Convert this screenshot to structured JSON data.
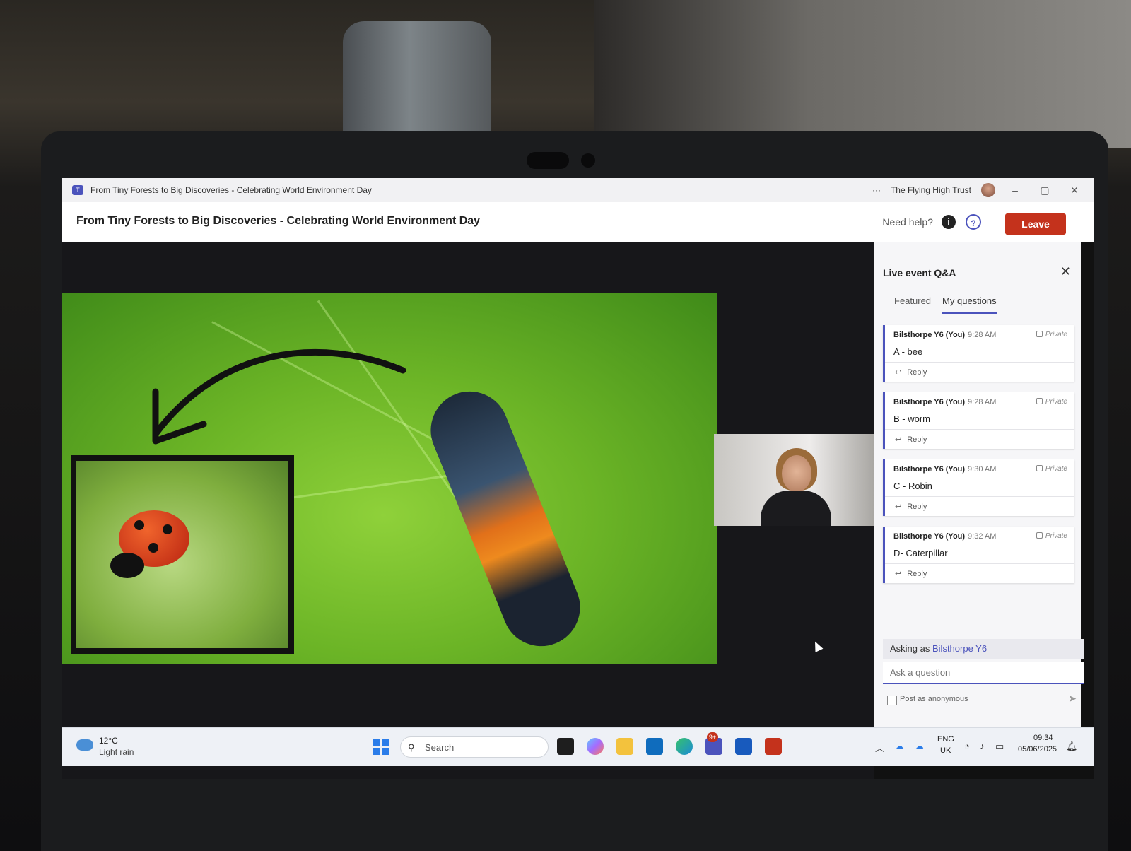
{
  "window": {
    "title": "From Tiny Forests to Big Discoveries - Celebrating World Environment Day",
    "more_label": "···",
    "org": "The Flying High Trust",
    "minimize": "–",
    "restore": "▢",
    "close": "✕"
  },
  "header": {
    "title": "From Tiny Forests to Big Discoveries - Celebrating World Environment Day",
    "need_help": "Need help?",
    "leave_label": "Leave"
  },
  "qa": {
    "title": "Live event Q&A",
    "tabs": [
      {
        "label": "Featured"
      },
      {
        "label": "My questions"
      }
    ],
    "questions": [
      {
        "author": "Bilsthorpe Y6 (You)",
        "time": "9:28 AM",
        "visibility": "Private",
        "text": "A - bee",
        "reply": "Reply"
      },
      {
        "author": "Bilsthorpe Y6 (You)",
        "time": "9:28 AM",
        "visibility": "Private",
        "text": "B - worm",
        "reply": "Reply"
      },
      {
        "author": "Bilsthorpe Y6 (You)",
        "time": "9:30 AM",
        "visibility": "Private",
        "text": "C - Robin",
        "reply": "Reply"
      },
      {
        "author": "Bilsthorpe Y6 (You)",
        "time": "9:32 AM",
        "visibility": "Private",
        "text": "D- Caterpillar",
        "reply": "Reply"
      }
    ],
    "asking_prefix": "Asking as",
    "asking_name": "Bilsthorpe Y6",
    "ask_placeholder": "Ask a question",
    "anonymous_label": "Post as anonymous"
  },
  "taskbar": {
    "weather_temp": "12°C",
    "weather_desc": "Light rain",
    "search_placeholder": "Search",
    "teams_badge": "9+",
    "lang": "ENG",
    "region": "UK",
    "time": "09:34",
    "date": "05/06/2025"
  },
  "colors": {
    "accent": "#4b53bc",
    "leave": "#c4321c"
  }
}
